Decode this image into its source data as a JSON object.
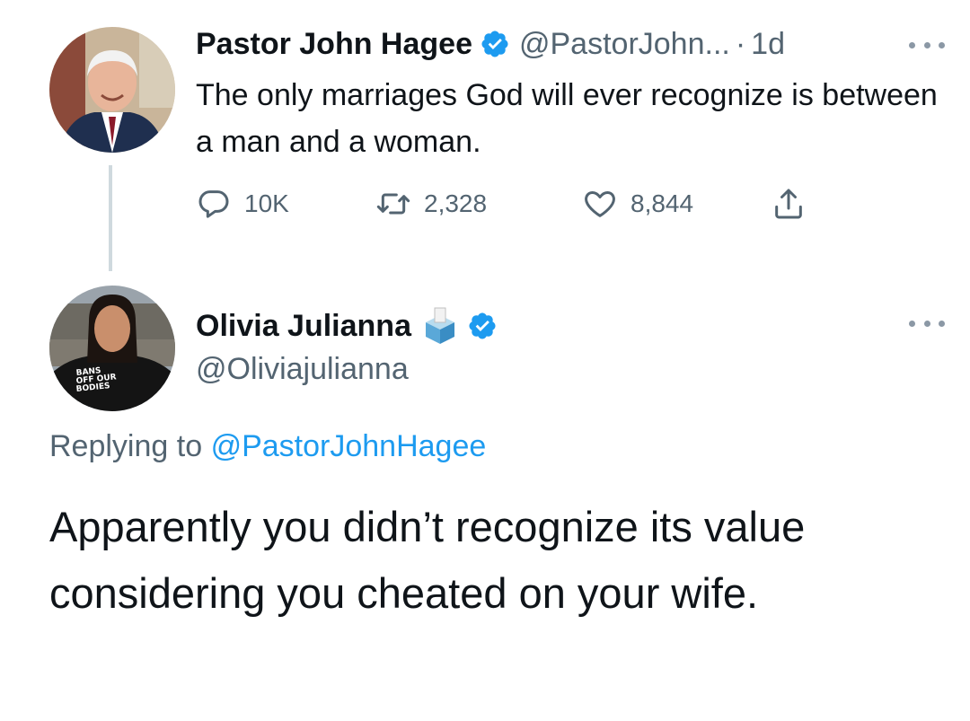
{
  "original_tweet": {
    "author_name": "Pastor John Hagee",
    "handle": "@PastorJohn...",
    "separator": "·",
    "time": "1d",
    "text": "The only marriages God will ever recognize is between a man and a woman.",
    "replies": "10K",
    "retweets": "2,328",
    "likes": "8,844",
    "verified": true
  },
  "reply_tweet": {
    "author_name": "Olivia Julianna",
    "handle": "@Oliviajulianna",
    "replying_prefix": "Replying to",
    "replying_to": "@PastorJohnHagee",
    "text": "Apparently you didn’t recognize its value considering you cheated on your wife.",
    "verified": true,
    "avatar_shirt_text": "BANS OFF OUR BODIES"
  },
  "colors": {
    "verified_blue": "#1d9bf0",
    "secondary_text": "#536471",
    "thread_line": "#cfd9de"
  }
}
